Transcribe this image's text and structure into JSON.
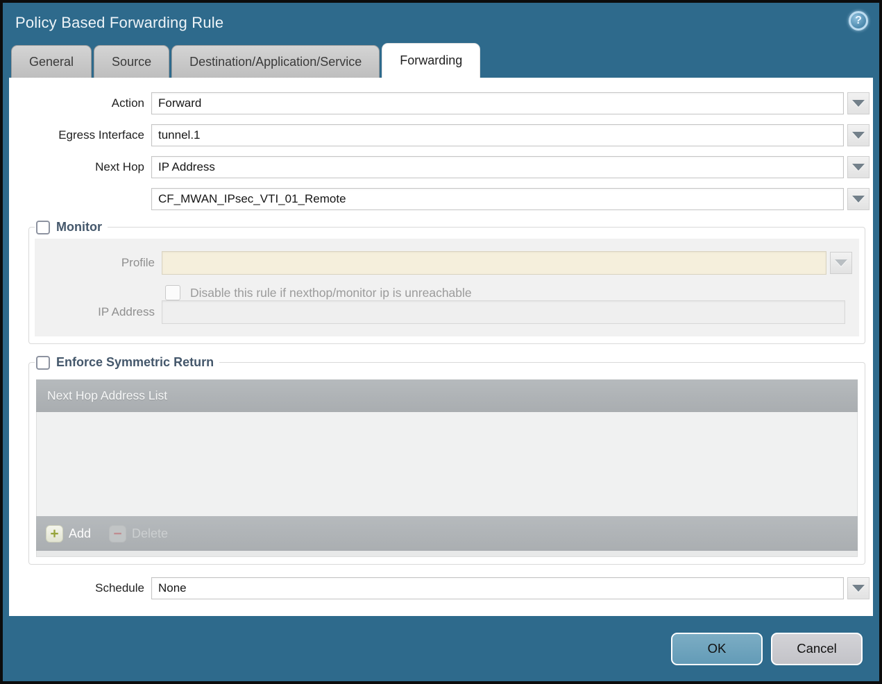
{
  "window": {
    "title": "Policy Based Forwarding Rule",
    "help_glyph": "?"
  },
  "tabs": [
    {
      "label": "General",
      "active": false
    },
    {
      "label": "Source",
      "active": false
    },
    {
      "label": "Destination/Application/Service",
      "active": false
    },
    {
      "label": "Forwarding",
      "active": true
    }
  ],
  "form": {
    "action": {
      "label": "Action",
      "value": "Forward"
    },
    "egress_interface": {
      "label": "Egress Interface",
      "value": "tunnel.1"
    },
    "next_hop": {
      "label": "Next Hop",
      "value": "IP Address"
    },
    "next_hop_address": {
      "value": "CF_MWAN_IPsec_VTI_01_Remote"
    },
    "schedule": {
      "label": "Schedule",
      "value": "None"
    }
  },
  "monitor": {
    "title": "Monitor",
    "profile": {
      "label": "Profile",
      "value": ""
    },
    "disable_checkbox_label": "Disable this rule if nexthop/monitor ip is unreachable",
    "ip_address": {
      "label": "IP Address",
      "value": ""
    }
  },
  "enforce": {
    "title": "Enforce Symmetric Return",
    "table_header": "Next Hop Address List",
    "add_label": "Add",
    "add_glyph": "+",
    "delete_label": "Delete",
    "delete_glyph": "−"
  },
  "footer": {
    "ok_label": "OK",
    "cancel_label": "Cancel"
  },
  "colors": {
    "accent_teal": "#2e6a8c",
    "active_tab": "#ffffff",
    "inactive_tab": "#c6c6c6",
    "section_title": "#44576b",
    "disabled_beige": "#f5efdc",
    "table_gray": "#aeb2b5",
    "ok_button": "#6da3be",
    "cancel_button": "#cbcbcf",
    "add_plus": "#97a43c",
    "delete_minus": "#c18b90"
  }
}
